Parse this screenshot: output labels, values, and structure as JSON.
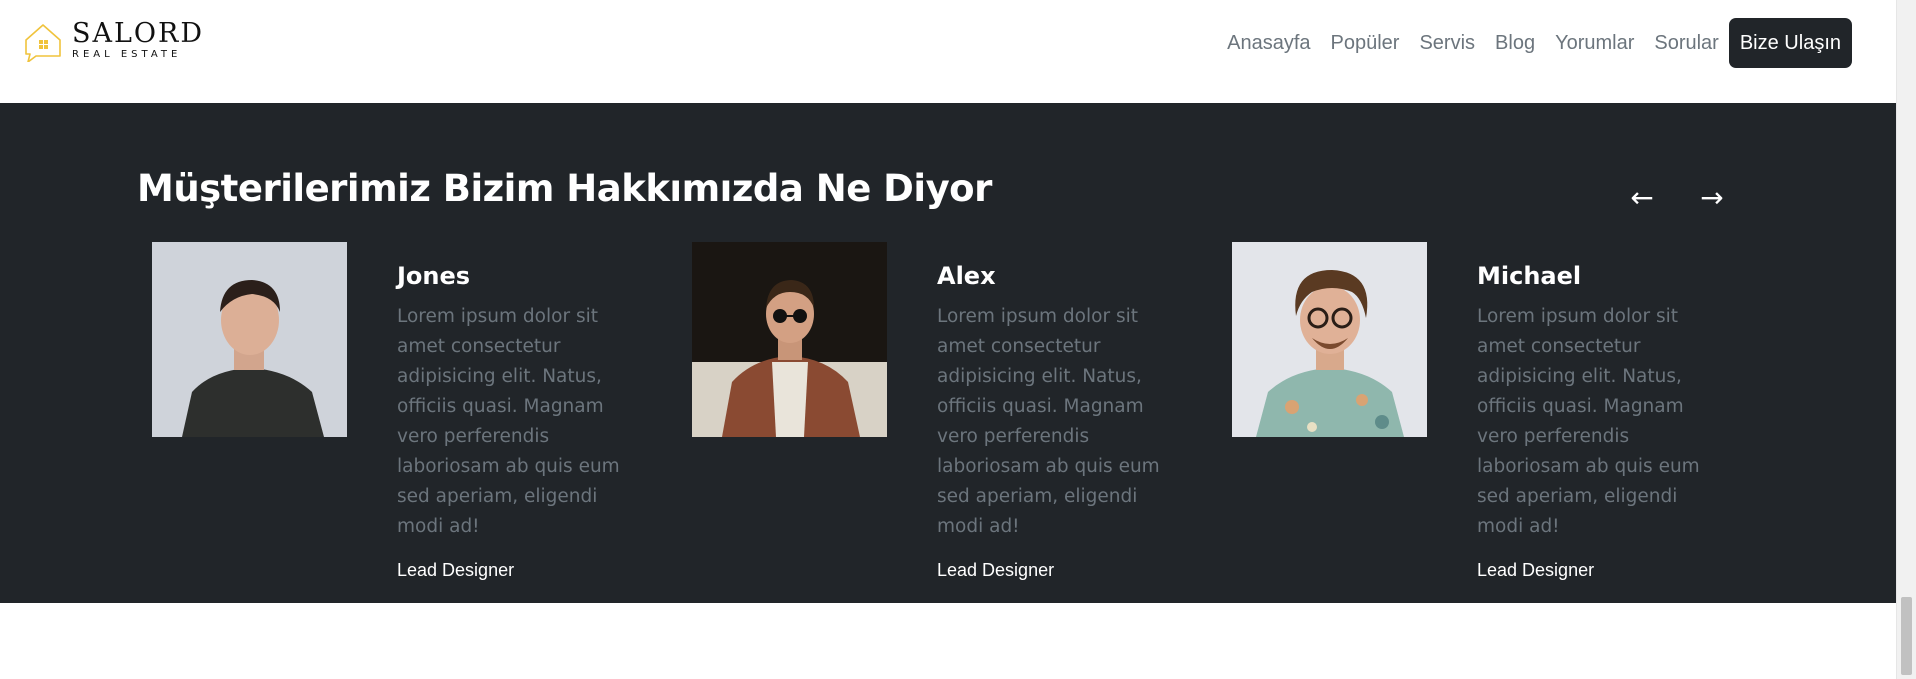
{
  "brand": {
    "title": "SALORD",
    "subtitle": "REAL ESTATE",
    "logo_icon": "house-outline-icon",
    "accent_color": "#f0c33c"
  },
  "nav": {
    "items": [
      "Anasayfa",
      "Popüler",
      "Servis",
      "Blog",
      "Yorumlar",
      "Sorular"
    ],
    "cta_label": "Bize Ulaşın"
  },
  "testimonials": {
    "title": "Müşterilerimiz Bizim Hakkımızda Ne Diyor",
    "prev_icon": "←",
    "next_icon": "→",
    "items": [
      {
        "name": "Jones",
        "text": "Lorem ipsum dolor sit amet consectetur adipisicing elit. Natus, officiis quasi. Magnam vero perferendis laboriosam ab quis eum sed aperiam, eligendi modi ad!",
        "role": "Lead Designer"
      },
      {
        "name": "Alex",
        "text": "Lorem ipsum dolor sit amet consectetur adipisicing elit. Natus, officiis quasi. Magnam vero perferendis laboriosam ab quis eum sed aperiam, eligendi modi ad!",
        "role": "Lead Designer"
      },
      {
        "name": "Michael",
        "text": "Lorem ipsum dolor sit amet consectetur adipisicing elit. Natus, officiis quasi. Magnam vero perferendis laboriosam ab quis eum sed aperiam, eligendi modi ad!",
        "role": "Lead Designer"
      }
    ]
  },
  "colors": {
    "dark_bg": "#212529",
    "muted_text": "#6c757d"
  }
}
